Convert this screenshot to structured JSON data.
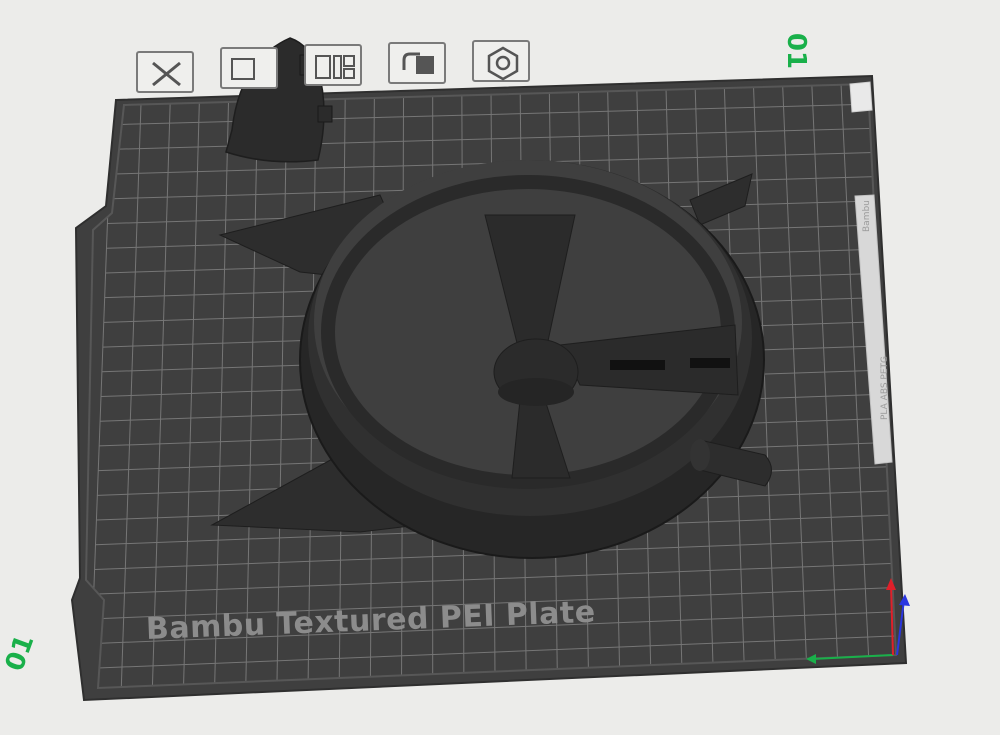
{
  "scene": {
    "plate_label": "Bambu Textured PEI Plate",
    "plate_number_top": "01",
    "plate_number_left": "01",
    "side_label": "PLA ABS PETG",
    "side_small_text": "Bambu"
  },
  "toolbar": {
    "buttons": [
      {
        "name": "delete-plate-button",
        "icon": "close-icon"
      },
      {
        "name": "arrange-button",
        "icon": "arrange-icon"
      },
      {
        "name": "layout-button",
        "icon": "layout-icon"
      },
      {
        "name": "lock-plate-button",
        "icon": "lock-icon"
      },
      {
        "name": "plate-settings-button",
        "icon": "hexagon-settings-icon"
      }
    ]
  },
  "colors": {
    "background": "#ececea",
    "plate": "#3f3f3f",
    "grid": "#6e6e6e",
    "model": "#2b2b2b",
    "plate_number": "#19b04a",
    "axis_x": "#19b04a",
    "axis_y": "#e0202a",
    "axis_z": "#2a36e0"
  }
}
